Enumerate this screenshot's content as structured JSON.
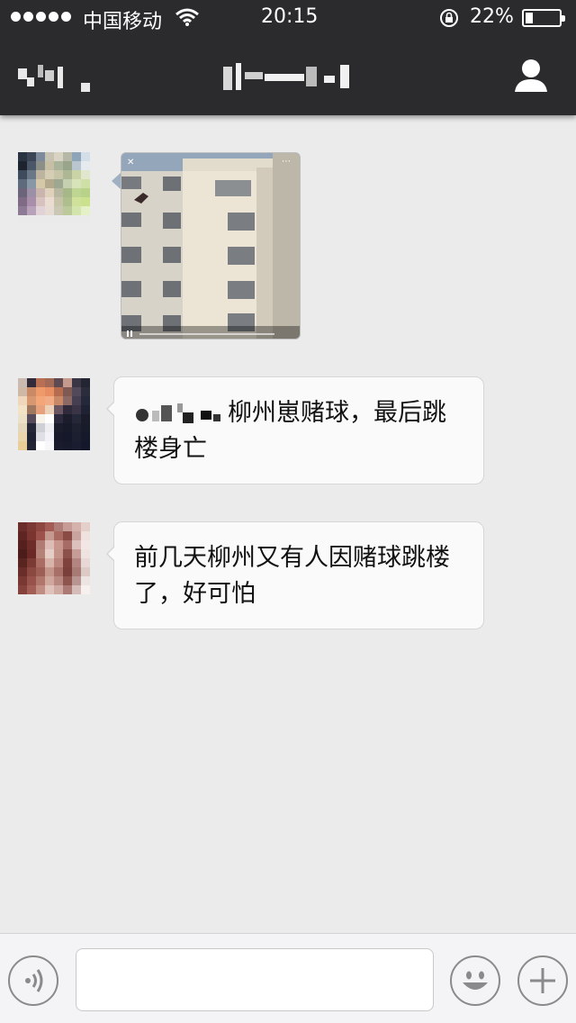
{
  "status_bar": {
    "carrier": "中国移动",
    "time": "20:15",
    "battery_percent": "22%",
    "battery_level": 0.22,
    "signal_dots": 5
  },
  "nav": {
    "back_label": "",
    "title": "",
    "back_redacted": true,
    "title_redacted": true,
    "right_icon": "person-icon"
  },
  "messages": [
    {
      "type": "video",
      "sender_redacted": true
    },
    {
      "type": "text",
      "name_redacted": true,
      "text": "柳州崽赌球，最后跳楼身亡"
    },
    {
      "type": "text",
      "text": "前几天柳州又有人因赌球跳楼了，好可怕"
    }
  ],
  "input_bar": {
    "voice_icon": "voice-icon",
    "emoji_icon": "smiley-icon",
    "plus_icon": "plus-icon",
    "input_value": "",
    "input_placeholder": ""
  },
  "colors": {
    "top_bar": "#2b2b2d",
    "chat_bg": "#ebebeb",
    "bubble": "#fafafa",
    "input_bar": "#f4f4f6"
  }
}
